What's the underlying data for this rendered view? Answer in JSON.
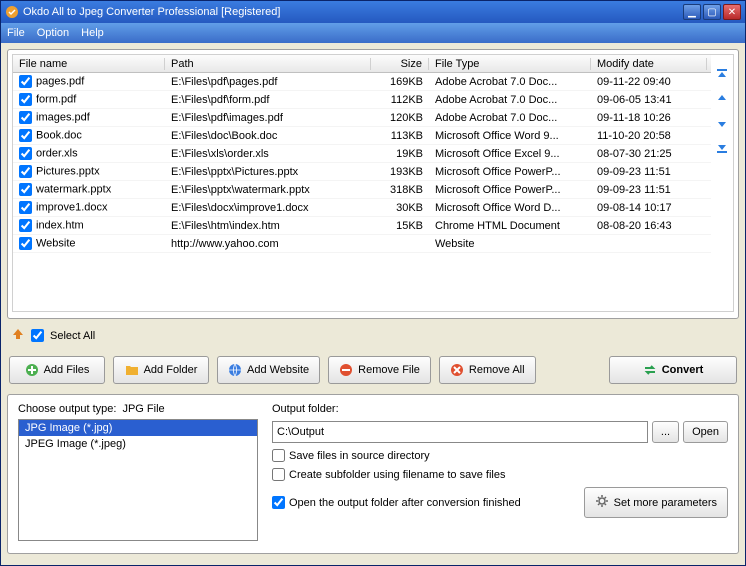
{
  "window": {
    "title": "Okdo All to Jpeg Converter Professional [Registered]"
  },
  "menu": {
    "file": "File",
    "option": "Option",
    "help": "Help"
  },
  "table": {
    "headers": {
      "name": "File name",
      "path": "Path",
      "size": "Size",
      "type": "File Type",
      "date": "Modify date"
    },
    "rows": [
      {
        "name": "pages.pdf",
        "path": "E:\\Files\\pdf\\pages.pdf",
        "size": "169KB",
        "type": "Adobe Acrobat 7.0 Doc...",
        "date": "09-11-22 09:40"
      },
      {
        "name": "form.pdf",
        "path": "E:\\Files\\pdf\\form.pdf",
        "size": "112KB",
        "type": "Adobe Acrobat 7.0 Doc...",
        "date": "09-06-05 13:41"
      },
      {
        "name": "images.pdf",
        "path": "E:\\Files\\pdf\\images.pdf",
        "size": "120KB",
        "type": "Adobe Acrobat 7.0 Doc...",
        "date": "09-11-18 10:26"
      },
      {
        "name": "Book.doc",
        "path": "E:\\Files\\doc\\Book.doc",
        "size": "113KB",
        "type": "Microsoft Office Word 9...",
        "date": "11-10-20 20:58"
      },
      {
        "name": "order.xls",
        "path": "E:\\Files\\xls\\order.xls",
        "size": "19KB",
        "type": "Microsoft Office Excel 9...",
        "date": "08-07-30 21:25"
      },
      {
        "name": "Pictures.pptx",
        "path": "E:\\Files\\pptx\\Pictures.pptx",
        "size": "193KB",
        "type": "Microsoft Office PowerP...",
        "date": "09-09-23 11:51"
      },
      {
        "name": "watermark.pptx",
        "path": "E:\\Files\\pptx\\watermark.pptx",
        "size": "318KB",
        "type": "Microsoft Office PowerP...",
        "date": "09-09-23 11:51"
      },
      {
        "name": "improve1.docx",
        "path": "E:\\Files\\docx\\improve1.docx",
        "size": "30KB",
        "type": "Microsoft Office Word D...",
        "date": "09-08-14 10:17"
      },
      {
        "name": "index.htm",
        "path": "E:\\Files\\htm\\index.htm",
        "size": "15KB",
        "type": "Chrome HTML Document",
        "date": "08-08-20 16:43"
      },
      {
        "name": "Website",
        "path": "http://www.yahoo.com",
        "size": "",
        "type": "Website",
        "date": ""
      }
    ]
  },
  "selectall_label": "Select All",
  "buttons": {
    "addfiles": "Add Files",
    "addfolder": "Add Folder",
    "addwebsite": "Add Website",
    "removefile": "Remove File",
    "removeall": "Remove All",
    "convert": "Convert"
  },
  "output_type": {
    "label": "Choose output type:",
    "current": "JPG File",
    "options": [
      "JPG Image (*.jpg)",
      "JPEG Image (*.jpeg)"
    ]
  },
  "output_folder": {
    "label": "Output folder:",
    "value": "C:\\Output",
    "browse": "...",
    "open": "Open",
    "opt_save_source": "Save files in source directory",
    "opt_subfolder": "Create subfolder using filename to save files",
    "opt_open_after": "Open the output folder after conversion finished",
    "more": "Set more parameters"
  }
}
